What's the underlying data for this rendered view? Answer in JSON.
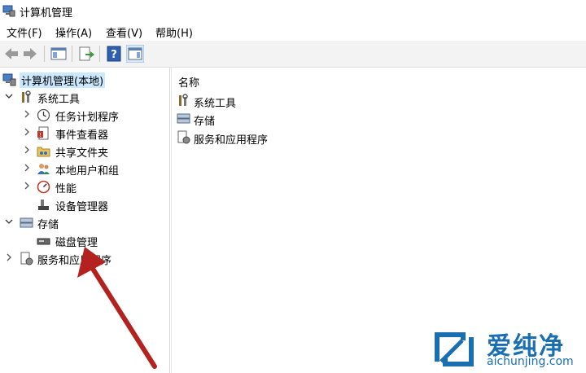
{
  "window": {
    "title": "计算机管理"
  },
  "menu": {
    "items": [
      "文件(F)",
      "操作(A)",
      "查看(V)",
      "帮助(H)"
    ]
  },
  "tree": {
    "root": "计算机管理(本地)",
    "system_tools": "系统工具",
    "task_scheduler": "任务计划程序",
    "event_viewer": "事件查看器",
    "shared_folders": "共享文件夹",
    "local_users": "本地用户和组",
    "performance": "性能",
    "device_manager": "设备管理器",
    "storage": "存储",
    "disk_management": "磁盘管理",
    "services_apps": "服务和应用程序"
  },
  "list": {
    "column_name": "名称",
    "items": [
      "系统工具",
      "存储",
      "服务和应用程序"
    ]
  },
  "watermark": {
    "brand": "爱纯净",
    "url": "aichunjing.com"
  },
  "colors": {
    "selection": "#cce8ff",
    "arrow": "#b3221e",
    "watermark": "#1a6fb0"
  }
}
